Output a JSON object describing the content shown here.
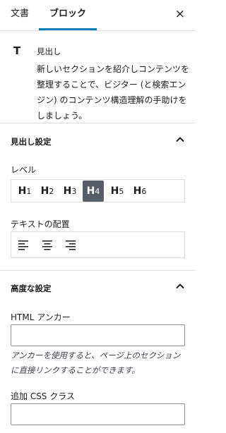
{
  "tabs": {
    "document": "文書",
    "block": "ブロック"
  },
  "close_icon": "×",
  "block_card": {
    "icon_text": "T",
    "title": "見出し",
    "description": "新しいセクションを紹介しコンテンツを整理することで、ビジター (と検索エンジン) のコンテンツ構造理解の手助けをしましょう。"
  },
  "heading_settings": {
    "title": "見出し設定",
    "level_label": "レベル",
    "levels": [
      {
        "h": "H",
        "n": "1"
      },
      {
        "h": "H",
        "n": "2"
      },
      {
        "h": "H",
        "n": "3"
      },
      {
        "h": "H",
        "n": "4"
      },
      {
        "h": "H",
        "n": "5"
      },
      {
        "h": "H",
        "n": "6"
      }
    ],
    "active_level": 4,
    "alignment_label": "テキストの配置"
  },
  "advanced": {
    "title": "高度な設定",
    "anchor_label": "HTML アンカー",
    "anchor_value": "",
    "anchor_help": "アンカーを使用すると、ページ上のセクションに直接リンクすることができます。",
    "css_label": "追加 CSS クラス",
    "css_value": ""
  },
  "colors": {
    "accent": "#007cba",
    "active_button": "#555d66",
    "border": "#e0e0e0"
  }
}
